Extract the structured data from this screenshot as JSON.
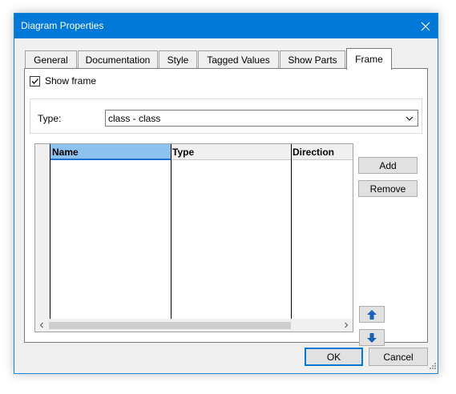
{
  "window": {
    "title": "Diagram Properties"
  },
  "tabs": [
    {
      "label": "General"
    },
    {
      "label": "Documentation"
    },
    {
      "label": "Style"
    },
    {
      "label": "Tagged Values"
    },
    {
      "label": "Show Parts"
    },
    {
      "label": "Frame",
      "active": true
    }
  ],
  "frame": {
    "show_frame_label": "Show frame",
    "show_frame_checked": true,
    "type_label": "Type:",
    "type_value": "class - class"
  },
  "grid": {
    "columns": [
      "Name",
      "Type",
      "Direction"
    ],
    "selected_column": "Name",
    "rows": []
  },
  "side_buttons": {
    "add": "Add",
    "remove": "Remove"
  },
  "footer": {
    "ok": "OK",
    "cancel": "Cancel"
  },
  "colors": {
    "accent": "#0078d7",
    "arrow_blue": "#1c5fb8",
    "selected_header": "#8ec2ee"
  }
}
